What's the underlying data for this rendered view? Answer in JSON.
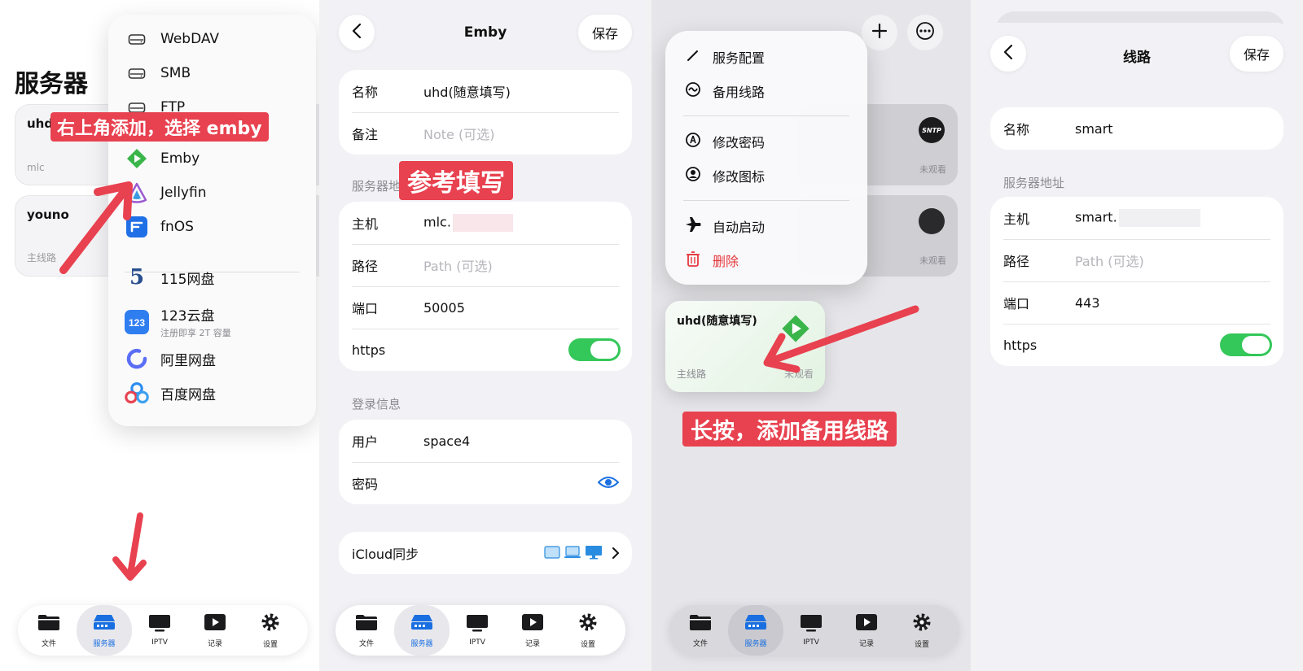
{
  "tabbar": {
    "items": [
      {
        "label": "文件",
        "icon": "folder-icon"
      },
      {
        "label": "服务器",
        "icon": "server-icon"
      },
      {
        "label": "IPTV",
        "icon": "tv-icon"
      },
      {
        "label": "记录",
        "icon": "play-icon"
      },
      {
        "label": "设置",
        "icon": "gear-icon"
      }
    ],
    "active_color": "#1a6fe0"
  },
  "panel1": {
    "title": "服务器",
    "servers": [
      {
        "name": "uhd",
        "route": "mlc"
      },
      {
        "name": "youno",
        "route": "主线路"
      }
    ],
    "menu": [
      {
        "label": "WebDAV",
        "icon": "drive-icon"
      },
      {
        "label": "SMB",
        "icon": "drive-icon"
      },
      {
        "label": "FTP",
        "icon": "drive-icon"
      },
      {
        "label": "Emby",
        "icon": "emby-icon"
      },
      {
        "label": "Jellyfin",
        "icon": "jellyfin-icon"
      },
      {
        "label": "fnOS",
        "icon": "fnos-icon"
      },
      {
        "label": "115网盘",
        "icon": "115-icon"
      },
      {
        "label": "123云盘",
        "sublabel": "注册即享 2T 容量",
        "icon": "123-icon"
      },
      {
        "label": "阿里网盘",
        "icon": "aliyun-icon"
      },
      {
        "label": "百度网盘",
        "icon": "baidu-icon"
      }
    ],
    "annotation": "右上角添加，选择 emby"
  },
  "panel2": {
    "title": "Emby",
    "save": "保存",
    "name_label": "名称",
    "name_value": "uhd(随意填写)",
    "note_label": "备注",
    "note_placeholder": "Note (可选)",
    "server_section": "服务器地",
    "host_label": "主机",
    "host_value": "mlc.",
    "path_label": "路径",
    "path_placeholder": "Path (可选)",
    "port_label": "端口",
    "port_value": "50005",
    "https_label": "https",
    "https_on": true,
    "login_section": "登录信息",
    "user_label": "用户",
    "user_value": "space4",
    "password_label": "密码",
    "icloud_label": "iCloud同步",
    "annotation": "参考填写"
  },
  "panel3": {
    "menu": [
      {
        "label": "服务配置",
        "icon": "pencil-icon"
      },
      {
        "label": "备用线路",
        "icon": "route-icon"
      },
      {
        "label": "修改密码",
        "icon": "key-icon"
      },
      {
        "label": "修改图标",
        "icon": "person-circle-icon"
      },
      {
        "label": "自动启动",
        "icon": "airplane-icon"
      },
      {
        "label": "删除",
        "icon": "trash-icon",
        "color": "#e5383b"
      }
    ],
    "card_name": "uhd(随意填写)",
    "card_route": "主线路",
    "card_status": "未观看",
    "bg_status_1": "未观看",
    "bg_status_2": "未观看",
    "avatar_text": "SNTP",
    "annotation": "长按，添加备用线路"
  },
  "panel4": {
    "title": "线路",
    "save": "保存",
    "name_label": "名称",
    "name_value": "smart",
    "server_section": "服务器地址",
    "host_label": "主机",
    "host_value": "smart.",
    "path_label": "路径",
    "path_placeholder": "Path (可选)",
    "port_label": "端口",
    "port_value": "443",
    "https_label": "https",
    "https_on": true
  },
  "colors": {
    "annotation_red": "#e8414f",
    "toggle_green": "#34c759",
    "link_blue": "#1a6fe0"
  }
}
